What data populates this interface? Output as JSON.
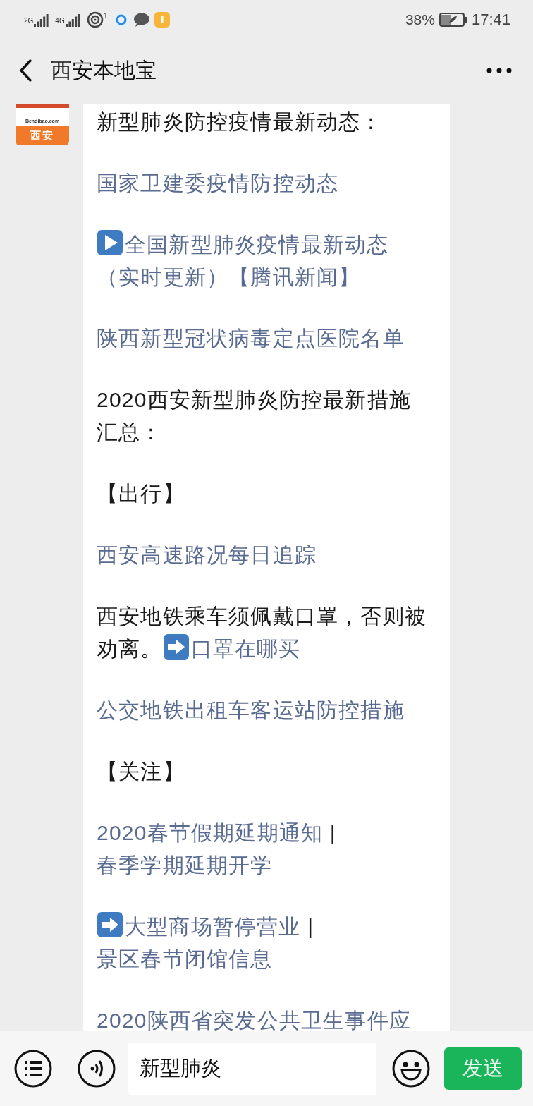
{
  "status_bar": {
    "networks": [
      "2G",
      "4G"
    ],
    "hotspot_count": "1",
    "battery": "38%",
    "time": "17:41"
  },
  "header": {
    "title": "西安本地宝"
  },
  "avatar": {
    "site": "Bendibao.com",
    "city": "西安"
  },
  "message": {
    "paragraphs": [
      {
        "segments": [
          {
            "kind": "text",
            "text": "新型肺炎防控疫情最新动态："
          }
        ]
      },
      {
        "segments": [
          {
            "kind": "link",
            "text": "国家卫建委疫情防控动态"
          }
        ]
      },
      {
        "segments": [
          {
            "kind": "play"
          },
          {
            "kind": "link",
            "text": "全国新型肺炎疫情最新动态"
          },
          {
            "kind": "link",
            "text": "（实时更新）【腾讯新闻】"
          }
        ]
      },
      {
        "segments": [
          {
            "kind": "link",
            "text": "陕西新型冠状病毒定点医院名单"
          }
        ]
      },
      {
        "segments": [
          {
            "kind": "text",
            "text": "2020西安新型肺炎防控最新措施汇总："
          }
        ]
      },
      {
        "segments": [
          {
            "kind": "text",
            "text": "【出行】"
          }
        ]
      },
      {
        "segments": [
          {
            "kind": "link",
            "text": "西安高速路况每日追踪"
          }
        ]
      },
      {
        "segments": [
          {
            "kind": "text",
            "text": "西安地铁乘车须佩戴口罩，否则被劝离。"
          },
          {
            "kind": "arrow"
          },
          {
            "kind": "link",
            "text": "口罩在哪买"
          }
        ]
      },
      {
        "segments": [
          {
            "kind": "link",
            "text": "公交地铁出租车客运站防控措施"
          }
        ]
      },
      {
        "segments": [
          {
            "kind": "text",
            "text": "【关注】"
          }
        ]
      },
      {
        "segments": [
          {
            "kind": "link",
            "text": "2020春节假期延期通知"
          },
          {
            "kind": "text",
            "text": " | "
          },
          {
            "kind": "link",
            "text": "春季学期延期开学"
          }
        ]
      },
      {
        "segments": [
          {
            "kind": "arrow"
          },
          {
            "kind": "link",
            "text": "大型商场暂停营业"
          },
          {
            "kind": "text",
            "text": " | "
          },
          {
            "kind": "link",
            "text": "景区春节闭馆信息"
          }
        ]
      },
      {
        "segments": [
          {
            "kind": "link",
            "text": "2020陕西省突发公共卫生事件应"
          }
        ]
      }
    ]
  },
  "input_bar": {
    "value": "新型肺炎",
    "send": "发送"
  }
}
